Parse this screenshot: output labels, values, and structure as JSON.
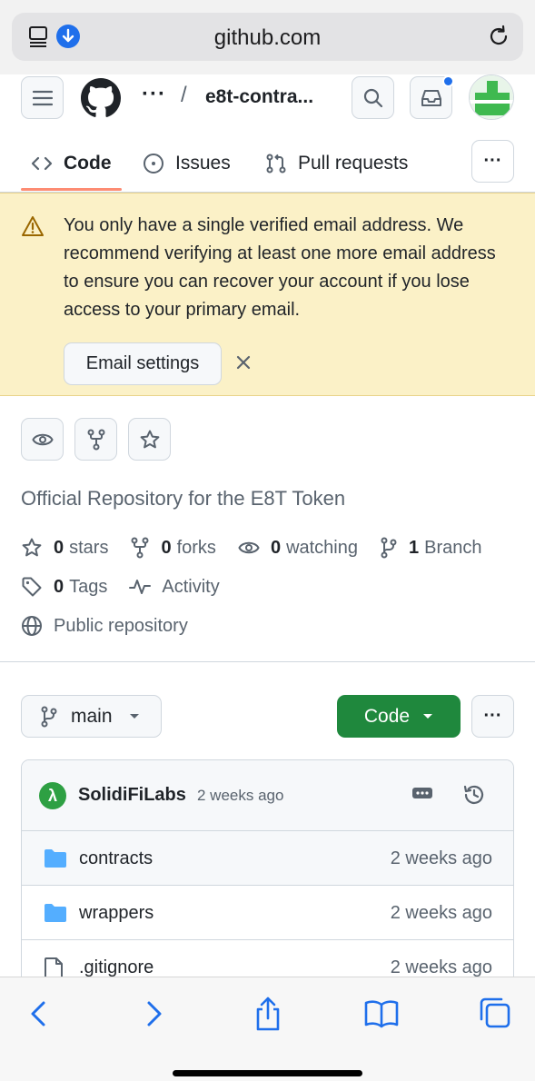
{
  "browser": {
    "url": "github.com",
    "icons": [
      "reader-view-icon",
      "download-icon",
      "reload-icon"
    ],
    "toolbar_icons": [
      "back-icon",
      "forward-icon",
      "share-icon",
      "bookmarks-icon",
      "tabs-icon"
    ]
  },
  "header": {
    "breadcrumb_ellipsis": "···",
    "breadcrumb_separator": "/",
    "repo_name": "e8t-contra..."
  },
  "tabs": [
    {
      "label": "Code",
      "icon": "code-icon",
      "active": true
    },
    {
      "label": "Issues",
      "icon": "issue-icon"
    },
    {
      "label": "Pull requests",
      "icon": "pull-request-icon"
    }
  ],
  "tabs_more": "···",
  "banner": {
    "message": "You only have a single verified email address. We recommend verifying at least one more email address to ensure you can recover your account if you lose access to your primary email.",
    "button": "Email settings"
  },
  "repo": {
    "description": "Official Repository for the E8T Token",
    "stars": {
      "count": "0",
      "label": "stars"
    },
    "forks": {
      "count": "0",
      "label": "forks"
    },
    "watching": {
      "count": "0",
      "label": "watching"
    },
    "branches": {
      "count": "1",
      "label": "Branch"
    },
    "tags": {
      "count": "0",
      "label": "Tags"
    },
    "activity": "Activity",
    "visibility": "Public repository"
  },
  "branch": {
    "name": "main"
  },
  "code_button": "Code",
  "more_button": "···",
  "commit": {
    "avatar_glyph": "λ",
    "author": "SolidiFiLabs",
    "time": "2 weeks ago"
  },
  "files": [
    {
      "name": "contracts",
      "type": "folder",
      "time": "2 weeks ago"
    },
    {
      "name": "wrappers",
      "type": "folder",
      "time": "2 weeks ago"
    },
    {
      "name": ".gitignore",
      "type": "file",
      "time": "2 weeks ago"
    }
  ],
  "colors": {
    "accent_blue": "#1f6feb",
    "code_green": "#1f883d",
    "banner_bg": "#fbf1c7",
    "tab_underline": "#fd8c73",
    "folder_blue": "#54aeff"
  }
}
